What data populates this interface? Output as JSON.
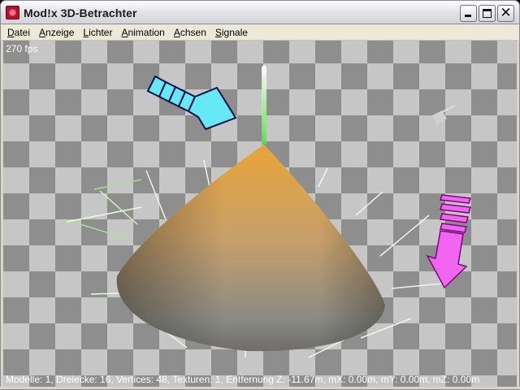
{
  "window": {
    "title": "Mod!x 3D-Betrachter",
    "minimize_icon": "minimize-icon",
    "maximize_icon": "maximize-icon",
    "close_icon": "close-icon"
  },
  "menu": {
    "items": [
      {
        "first": "D",
        "rest": "atei"
      },
      {
        "first": "A",
        "rest": "nzeige"
      },
      {
        "first": "L",
        "rest": "ichter"
      },
      {
        "first": "A",
        "rest": "nimation"
      },
      {
        "first": "A",
        "rest": "chsen"
      },
      {
        "first": "S",
        "rest": "ignale"
      }
    ]
  },
  "viewport": {
    "fps": "270 fps",
    "status": "Modelle: 1, Dreiecke: 16, Vertices: 48, Texturen: 1, Entfernung Z: -11.67m, mX: 0.00m, mY: 0.00m, mZ: 0.00m",
    "colors": {
      "checker_dark": "#8e8e8e",
      "checker_light": "#c6c6c6",
      "cone_top": "#e0a03a",
      "cone_bottom": "#6f6e6a",
      "arrow_cyan": "#66e8f6",
      "arrow_magenta": "#f066f0",
      "normal_line": "#7fe07a"
    }
  }
}
